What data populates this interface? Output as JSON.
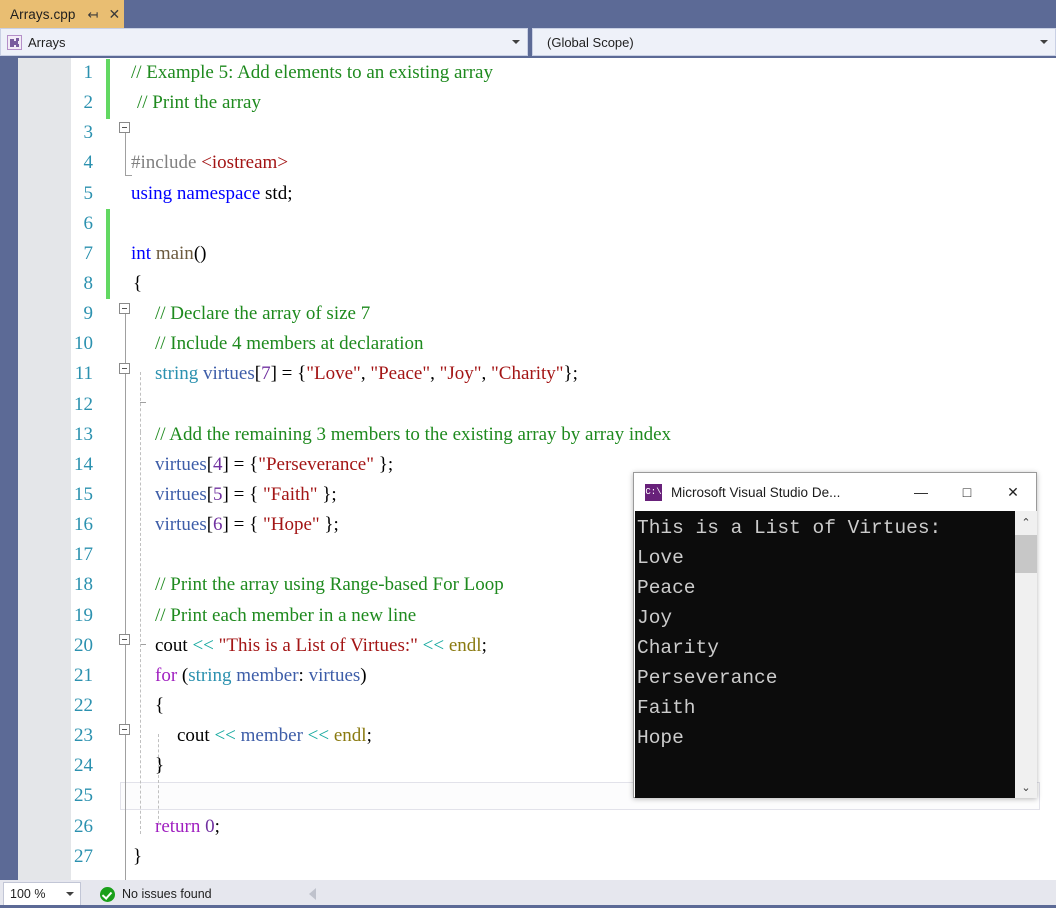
{
  "window": {
    "tab": {
      "label": "Arrays.cpp",
      "pin_icon": "pin-icon",
      "close_icon": "close-icon"
    }
  },
  "navbar": {
    "left": {
      "icon": "class-selector-icon",
      "value": "Arrays",
      "caret": "chevron-down-icon"
    },
    "right": {
      "value": "(Global Scope)",
      "caret": "chevron-down-icon"
    }
  },
  "editor": {
    "line_numbers": [
      "1",
      "2",
      "3",
      "4",
      "5",
      "6",
      "7",
      "8",
      "9",
      "10",
      "11",
      "12",
      "13",
      "14",
      "15",
      "16",
      "17",
      "18",
      "19",
      "20",
      "21",
      "22",
      "23",
      "24",
      "25",
      "26",
      "27"
    ],
    "lines": [
      {
        "n": "1",
        "text": "// Example 5: Add elements to an existing array"
      },
      {
        "n": "2",
        "text": "// Print the array"
      },
      {
        "n": "3",
        "text": ""
      },
      {
        "n": "4",
        "text": "#include <iostream>"
      },
      {
        "n": "5",
        "text": "using namespace std;"
      },
      {
        "n": "6",
        "text": ""
      },
      {
        "n": "7",
        "text": "int main()"
      },
      {
        "n": "8",
        "text": "{"
      },
      {
        "n": "9",
        "text": "    // Declare the array of size 7"
      },
      {
        "n": "10",
        "text": "    // Include 4 members at declaration"
      },
      {
        "n": "11",
        "text": "    string virtues[7] = {\"Love\", \"Peace\", \"Joy\", \"Charity\"};"
      },
      {
        "n": "12",
        "text": ""
      },
      {
        "n": "13",
        "text": "    // Add the remaining 3 members to the existing array by array index"
      },
      {
        "n": "14",
        "text": "    virtues[4] = {\"Perseverance\" };"
      },
      {
        "n": "15",
        "text": "    virtues[5] = { \"Faith\" };"
      },
      {
        "n": "16",
        "text": "    virtues[6] = { \"Hope\" };"
      },
      {
        "n": "17",
        "text": ""
      },
      {
        "n": "18",
        "text": "    // Print the array using Range-based For Loop"
      },
      {
        "n": "19",
        "text": "    // Print each member in a new line"
      },
      {
        "n": "20",
        "text": "    cout << \"This is a List of Virtues:\" << endl;"
      },
      {
        "n": "21",
        "text": "    for (string member: virtues)"
      },
      {
        "n": "22",
        "text": "    {"
      },
      {
        "n": "23",
        "text": "        cout << member << endl;"
      },
      {
        "n": "24",
        "text": "    }"
      },
      {
        "n": "25",
        "text": ""
      },
      {
        "n": "26",
        "text": "    return 0;"
      },
      {
        "n": "27",
        "text": "}"
      }
    ],
    "current_line": "25",
    "colors": {
      "comment": "#1E8A1E",
      "keyword": "#0000FF",
      "keyword_control": "#A020C0",
      "type": "#2B91AF",
      "string": "#A31515",
      "preprocessor": "#808080",
      "operator": "#13A89E",
      "macro": "#8A7A10",
      "number": "#7030A0",
      "linenumber": "#2B91AF",
      "change_bar": "#62D862"
    }
  },
  "console": {
    "title": "Microsoft Visual Studio De...",
    "app_icon": "console-icon",
    "minimize": "—",
    "maximize": "□",
    "close": "✕",
    "scroll_up": "⌃",
    "scroll_down": "⌄",
    "output": [
      "This is a List of Virtues:",
      "Love",
      "Peace",
      "Joy",
      "Charity",
      "Perseverance",
      "Faith",
      "Hope"
    ]
  },
  "statusbar": {
    "zoom": "100 %",
    "zoom_caret": "chevron-down-icon",
    "issue_icon": "success-check-icon",
    "message": "No issues found",
    "hscroll_left": "scroll-left-arrow-icon"
  }
}
